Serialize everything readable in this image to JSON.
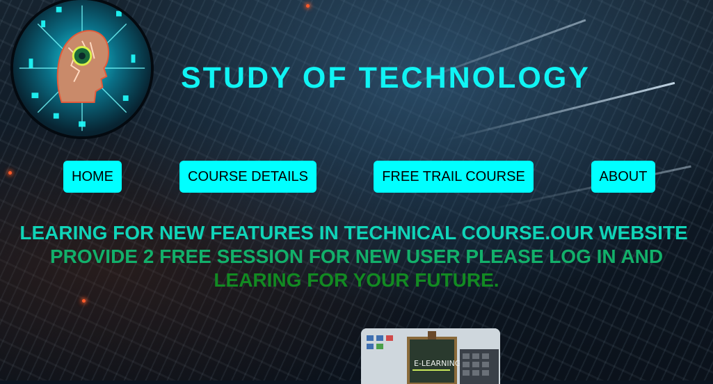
{
  "site": {
    "title": "STUDY OF TECHNOLOGY"
  },
  "nav": {
    "items": [
      {
        "label": "HOME"
      },
      {
        "label": "COURSE DETAILS"
      },
      {
        "label": "FREE TRAIL COURSE"
      },
      {
        "label": "ABOUT"
      }
    ]
  },
  "intro": {
    "line1": "LEARING FOR NEW FEATURES IN TECHNICAL COURSE.OUR WEBSITE",
    "line2": "PROVIDE 2 FREE SESSION FOR NEW USER PLEASE LOG IN AND",
    "line3": "LEARING FOR YOUR FUTURE."
  },
  "card": {
    "chalkboard_text": "E-LEARNING"
  },
  "colors": {
    "accent": "#00ffff",
    "title": "#10f4f4",
    "intro_top": "#10d4b8",
    "intro_mid": "#12b06a",
    "intro_bottom": "#128a22"
  }
}
